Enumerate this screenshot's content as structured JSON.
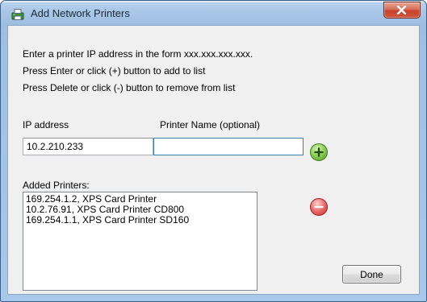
{
  "window": {
    "title": "Add Network Printers",
    "icon": "printer-icon"
  },
  "instructions": [
    "Enter a printer IP address in the form xxx.xxx.xxx.xxx.",
    "Press Enter or click (+) button to add to list",
    "Press Delete or click (-) button to remove from list"
  ],
  "form": {
    "ip_label": "IP address",
    "ip_value": "10.2.210.233",
    "name_label": "Printer Name (optional)",
    "name_value": ""
  },
  "list": {
    "label": "Added Printers:",
    "items": [
      "169.254.1.2, XPS Card Printer",
      "10.2.76.91, XPS Card Printer CD800",
      "169.254.1.1, XPS Card Printer SD160"
    ]
  },
  "buttons": {
    "done_label": "Done",
    "add_icon": "plus-circle-icon",
    "remove_icon": "minus-circle-icon"
  },
  "colors": {
    "add_green": "#5aa62c",
    "remove_red": "#d13b3b",
    "close_red": "#c8412a"
  }
}
